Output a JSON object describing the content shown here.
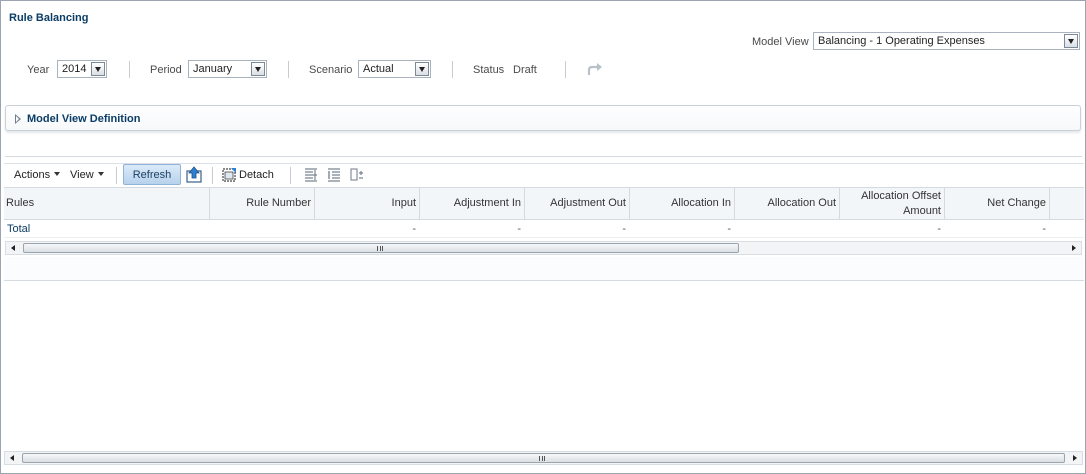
{
  "page": {
    "title": "Rule Balancing"
  },
  "model_view": {
    "label": "Model View",
    "value": "Balancing - 1 Operating Expenses"
  },
  "filters": {
    "year": {
      "label": "Year",
      "value": "2014"
    },
    "period": {
      "label": "Period",
      "value": "January"
    },
    "scenario": {
      "label": "Scenario",
      "value": "Actual"
    },
    "status": {
      "label": "Status",
      "value": "Draft"
    }
  },
  "model_view_definition": {
    "title": "Model View Definition"
  },
  "toolbar": {
    "actions_label": "Actions",
    "view_label": "View",
    "refresh_label": "Refresh",
    "detach_label": "Detach",
    "icons": [
      "export-icon",
      "detach-icon",
      "freeze-columns-icon",
      "wrap-columns-icon",
      "reorder-columns-icon",
      "redo-icon"
    ]
  },
  "table": {
    "columns": [
      "Rules",
      "Rule Number",
      "Input",
      "Adjustment In",
      "Adjustment Out",
      "Allocation In",
      "Allocation Out",
      [
        "Allocation Offset",
        "Amount"
      ],
      "Net Change"
    ],
    "rows": [
      {
        "rules": "Total",
        "rule_number": "",
        "input": "-",
        "adjustment_in": "-",
        "adjustment_out": "-",
        "allocation_in": "-",
        "allocation_out": "",
        "allocation_offset_amount": "-",
        "net_change": "-"
      }
    ]
  },
  "colors": {
    "accent": "#0b3d66",
    "button_bg": "#c6ddf2",
    "header_bg": "#f3f6f9",
    "border": "#d4dae0"
  }
}
